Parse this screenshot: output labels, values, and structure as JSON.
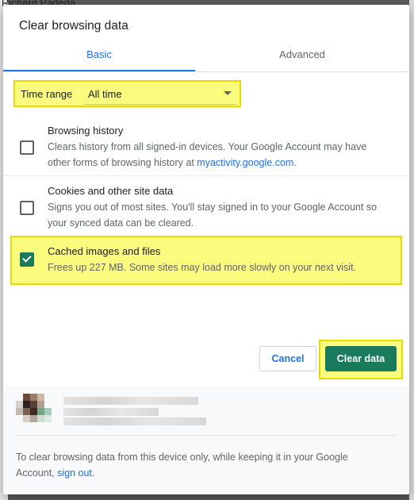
{
  "background": {
    "partial_text": "Richard Padeda"
  },
  "dialog": {
    "title": "Clear browsing data",
    "tabs": [
      {
        "label": "Basic",
        "active": true
      },
      {
        "label": "Advanced",
        "active": false
      }
    ],
    "time_range": {
      "label": "Time range",
      "value": "All time"
    },
    "options": [
      {
        "title": "Browsing history",
        "desc_before_link": "Clears history from all signed-in devices. Your Google Account may have other forms of browsing history at ",
        "link": "myactivity.google.com",
        "desc_after_link": ".",
        "checked": false
      },
      {
        "title": "Cookies and other site data",
        "desc": "Signs you out of most sites. You'll stay signed in to your Google Account so your synced data can be cleared.",
        "checked": false
      },
      {
        "title": "Cached images and files",
        "desc": "Frees up 227 MB. Some sites may load more slowly on your next visit.",
        "checked": true
      }
    ],
    "buttons": {
      "cancel": "Cancel",
      "clear": "Clear data"
    },
    "footer": {
      "note_before_link": "To clear browsing data from this device only, while keeping it in your Google Account, ",
      "link": "sign out",
      "note_after_link": "."
    }
  },
  "colors": {
    "accent_blue": "#1a73e8",
    "action_green": "#1a7a5c",
    "highlight_yellow": "#fbfb7e",
    "highlight_border": "#e5db00"
  }
}
